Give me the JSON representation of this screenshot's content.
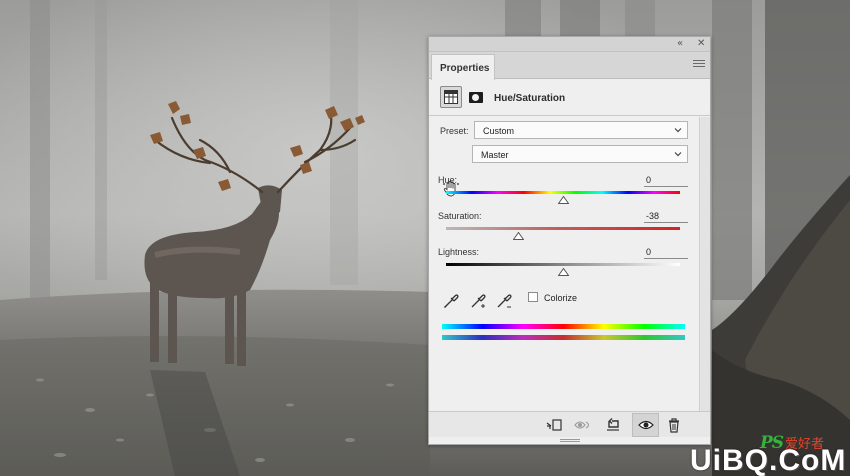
{
  "panel": {
    "collapse_glyph": "«",
    "close_glyph": "✕",
    "tab_label": "Properties",
    "title": "Hue/Saturation",
    "icons": [
      "hue-saturation-adjustment-icon",
      "layer-mask-icon",
      "panel-menu-icon"
    ]
  },
  "preset": {
    "label": "Preset:",
    "value": "Custom"
  },
  "channel": {
    "value": "Master"
  },
  "hue": {
    "label": "Hue:",
    "value": "0",
    "level": 0.5
  },
  "saturation": {
    "label": "Saturation:",
    "value": "-38",
    "level": 0.31
  },
  "lightness": {
    "label": "Lightness:",
    "value": "0",
    "level": 0.5
  },
  "colorize": {
    "label": "Colorize",
    "checked": false
  },
  "footer_icons": [
    "clip-to-layer-icon",
    "view-previous-state-icon",
    "reset-icon",
    "visibility-eye-icon",
    "delete-trash-icon"
  ],
  "watermark": {
    "brand": "PS",
    "brand_cjk": "爱好者",
    "domain": "UiBQ.CoM"
  },
  "colors": {
    "panel_bg": "#efefef",
    "spectrum": [
      "#ff0000",
      "#ffff00",
      "#00ff00",
      "#00ffff",
      "#0000ff",
      "#ff00ff",
      "#ff0000"
    ]
  }
}
